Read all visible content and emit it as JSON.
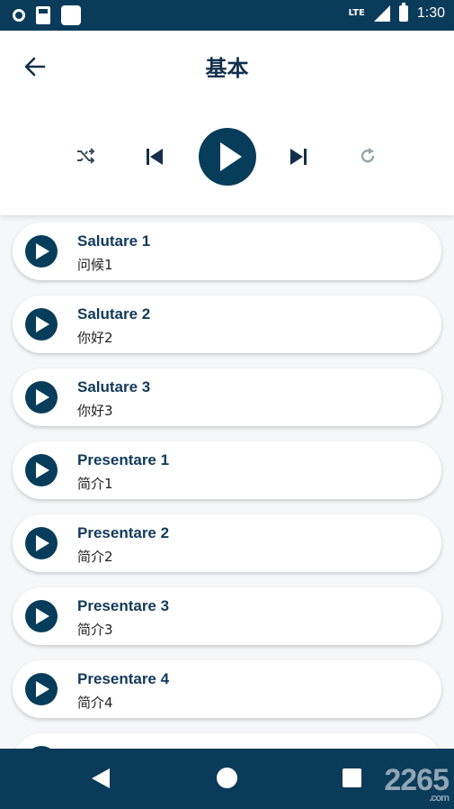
{
  "status_bar": {
    "network": "LTE",
    "time": "1:30",
    "icons": [
      "circle-icon",
      "sd-card-icon",
      "square-icon",
      "signal-icon",
      "battery-icon"
    ]
  },
  "header": {
    "title": "基本",
    "back_icon": "arrow-left-icon"
  },
  "player_controls": {
    "icons": [
      "shuffle-icon",
      "skip-previous-icon",
      "play-icon",
      "skip-next-icon",
      "repeat-icon"
    ]
  },
  "lessons": [
    {
      "title": "Salutare 1",
      "subtitle": "问候1"
    },
    {
      "title": "Salutare 2",
      "subtitle": "你好2"
    },
    {
      "title": "Salutare 3",
      "subtitle": "你好3"
    },
    {
      "title": "Presentare 1",
      "subtitle": "简介1"
    },
    {
      "title": "Presentare 2",
      "subtitle": "简介2"
    },
    {
      "title": "Presentare 3",
      "subtitle": "简介3"
    },
    {
      "title": "Presentare 4",
      "subtitle": "简介4"
    }
  ],
  "nav_bar": {
    "icons": [
      "nav-back-icon",
      "nav-home-icon",
      "nav-recent-icon"
    ],
    "watermark": "2265",
    "watermark_sub": ".com"
  },
  "colors": {
    "primary": "#073d5b",
    "background": "#f6f7f8",
    "card": "#ffffff"
  }
}
